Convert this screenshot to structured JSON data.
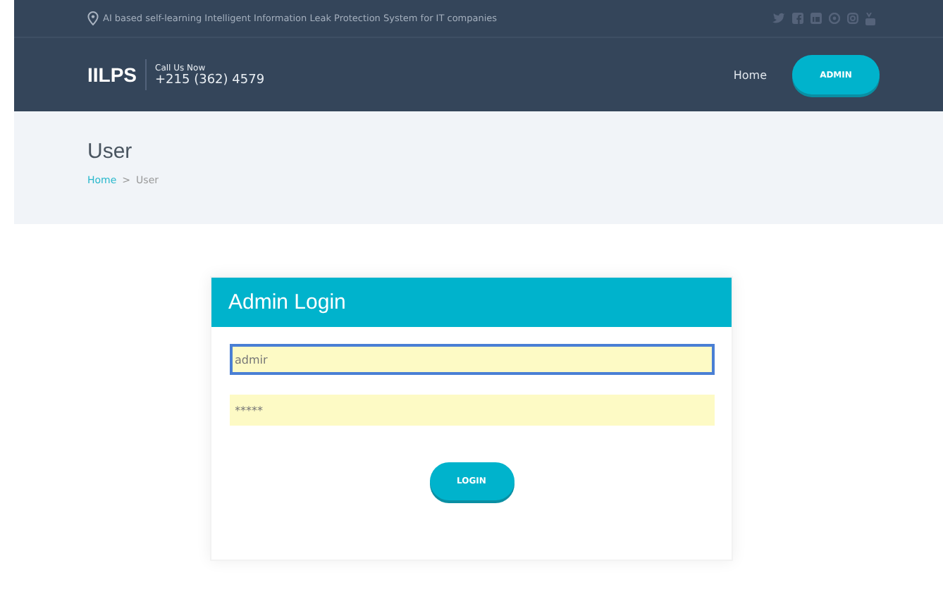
{
  "top_bar": {
    "tagline": "AI based self-learning Intelligent Information Leak Protection System for IT companies"
  },
  "header": {
    "logo": "IILPS",
    "call_label": "Call Us Now",
    "phone": "+215 (362) 4579",
    "nav": [
      {
        "label": "Home",
        "kind": "link"
      },
      {
        "label": "ADMIN",
        "kind": "button"
      }
    ]
  },
  "page_title": {
    "title": "User",
    "breadcrumb": [
      {
        "label": "Home",
        "kind": "link"
      },
      {
        "label": ">",
        "kind": "separator"
      },
      {
        "label": "User",
        "kind": "current"
      }
    ]
  },
  "login": {
    "title": "Admin Login",
    "fields": [
      {
        "value": "admir",
        "focused": true
      },
      {
        "value": "*****",
        "focused": false
      }
    ],
    "button": "LOGIN"
  }
}
